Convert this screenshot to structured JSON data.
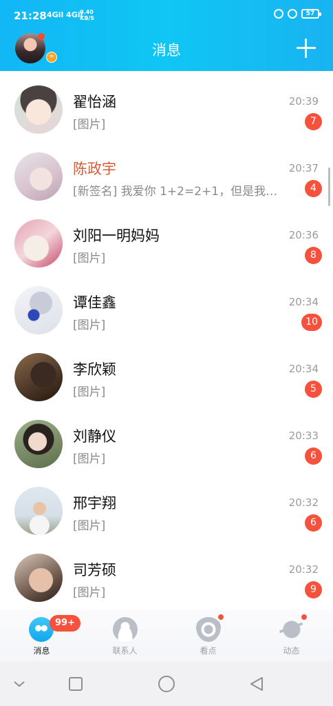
{
  "status_bar": {
    "time": "21:28",
    "network": "4Gil 4Gil",
    "speed_value": "0.40",
    "speed_unit": "KB/S",
    "battery": "57"
  },
  "header": {
    "title": "消息",
    "plus_icon": "plus-icon",
    "profile_badge": "="
  },
  "conversations": [
    {
      "name": "翟怡涵",
      "preview": "[图片]",
      "time": "20:39",
      "unread": "7"
    },
    {
      "name": "陈政宇",
      "preview": "[新签名] 我爱你 1+2=2+1，但是我爱你…",
      "time": "20:37",
      "unread": "4",
      "name_color": "#d95c38"
    },
    {
      "name": "刘阳一明妈妈",
      "preview": "[图片]",
      "time": "20:36",
      "unread": "8"
    },
    {
      "name": "谭佳鑫",
      "preview": "[图片]",
      "time": "20:34",
      "unread": "10"
    },
    {
      "name": "李欣颖",
      "preview": "[图片]",
      "time": "20:34",
      "unread": "5"
    },
    {
      "name": "刘静仪",
      "preview": "[图片]",
      "time": "20:33",
      "unread": "6"
    },
    {
      "name": "邢宇翔",
      "preview": "[图片]",
      "time": "20:32",
      "unread": "6"
    },
    {
      "name": "司芳硕",
      "preview": "[图片]",
      "time": "20:32",
      "unread": "9"
    }
  ],
  "tabs": [
    {
      "label": "消息",
      "icon": "chat-penguin-icon",
      "badge": "99+"
    },
    {
      "label": "联系人",
      "icon": "contacts-icon"
    },
    {
      "label": "看点",
      "icon": "eye-icon"
    },
    {
      "label": "动态",
      "icon": "planet-icon"
    }
  ],
  "system_nav": [
    "chevron-down-icon",
    "recents-square-icon",
    "home-circle-icon",
    "back-triangle-icon"
  ],
  "colors": {
    "header": "#12b7f5",
    "badge": "#f5513c",
    "highlight_name": "#d95c38"
  }
}
